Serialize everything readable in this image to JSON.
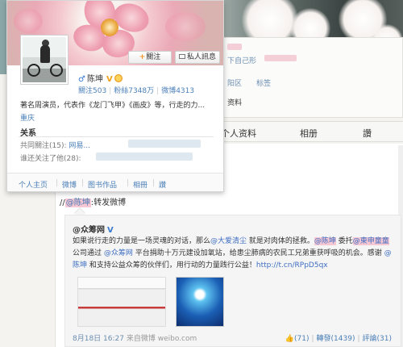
{
  "background": {
    "strip": {
      "line1": "下自己形",
      "line2": "阳区",
      "tag": "标签",
      "tab_label": "资料"
    },
    "tabs": [
      "个人资料",
      "相册",
      "讚"
    ]
  },
  "popup": {
    "follow_label": "關注",
    "message_label": "私人訊息",
    "name": "陈坤",
    "gender_icon": "♂",
    "verified_icon": "V",
    "stats": {
      "following": "關注503",
      "fans": "粉絲7348万",
      "weibo": "微博4313"
    },
    "bio": "著名周演员，代表作《龙门飞甲》《画皮》等，行走的力...",
    "location": "重庆",
    "relations_title": "关系",
    "common_follow": "共同關注(15):",
    "common_names": "网易...",
    "mutual": "谁还关注了他(28):",
    "footer": [
      "个人主页",
      "微博",
      "图书作品",
      "相冊",
      "讚"
    ]
  },
  "repost": {
    "prefix": "//",
    "mention": "@陈坤",
    "text": ":转发微博"
  },
  "original": {
    "author": "@众筹网",
    "verified_icon": "V",
    "segments": [
      {
        "t": "如果说行走的力量是一场灵魂的对话，那么",
        "c": ""
      },
      {
        "t": "@大爱清尘",
        "c": "lnk"
      },
      {
        "t": " 就是对肉体的拯救。",
        "c": ""
      },
      {
        "t": "@陈坤",
        "c": "hl"
      },
      {
        "t": " 委托",
        "c": ""
      },
      {
        "t": "@東申童童",
        "c": "hl"
      },
      {
        "t": " 公司通过 ",
        "c": ""
      },
      {
        "t": "@众筹网",
        "c": "lnk"
      },
      {
        "t": " 平台捐助十万元建设加氧站，给患尘肺病的农民工兄弟重获呼吸的机会。感谢 ",
        "c": ""
      },
      {
        "t": "@陈坤",
        "c": "lnk"
      },
      {
        "t": " 和支持公益众筹的伙伴们，用行动的力量践行公益！",
        "c": ""
      },
      {
        "t": "http://t.cn/RPpD5qx",
        "c": "lnk"
      }
    ],
    "date": "8月18日 16:27",
    "source": "来自微博 weibo.com",
    "likes": "(71)",
    "reposts": "轉發(1439)",
    "comments": "評論(31)"
  }
}
